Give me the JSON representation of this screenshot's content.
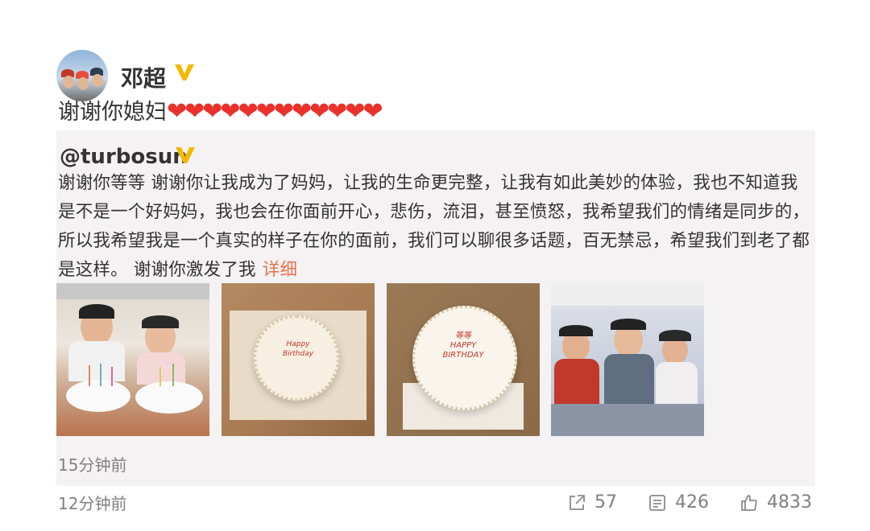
{
  "post": {
    "author": "邓超",
    "text": "谢谢你媳妇",
    "hearts": [
      "❤",
      "❤",
      "❤",
      "❤",
      "❤",
      "❤",
      "❤",
      "❤",
      "❤",
      "❤",
      "❤",
      "❤"
    ],
    "time": "12分钟前"
  },
  "repost": {
    "author": "@turbosun",
    "text": "谢谢你等等  谢谢你让我成为了妈妈，让我的生命更完整，让我有如此美妙的体验，我也不知道我是不是一个好妈妈，我也会在你面前开心，悲伤，流泪，甚至愤怒，我希望我们的情绪是同步的，所以我希望我是一个真实的样子在你的面前，我们可以聊很多话题，百无禁忌，希望我们到老了都是这样。 谢谢你激发了我",
    "detail_link": "详细",
    "time": "15分钟前",
    "photos": [
      {
        "name": "childhood-birthday-photo"
      },
      {
        "name": "cake-photo-1",
        "cake_text": "Happy\nBirthday"
      },
      {
        "name": "cake-photo-2",
        "cake_text": "等等\nHAPPY\nBIRTHDAY"
      },
      {
        "name": "three-girls-photo"
      }
    ]
  },
  "actions": {
    "share_count": "57",
    "comment_count": "426",
    "like_count": "4833"
  },
  "colors": {
    "verified": "#f5b800",
    "heart": "#e8322b",
    "link": "#eb7350",
    "repost_bg": "#f5f2f3"
  }
}
